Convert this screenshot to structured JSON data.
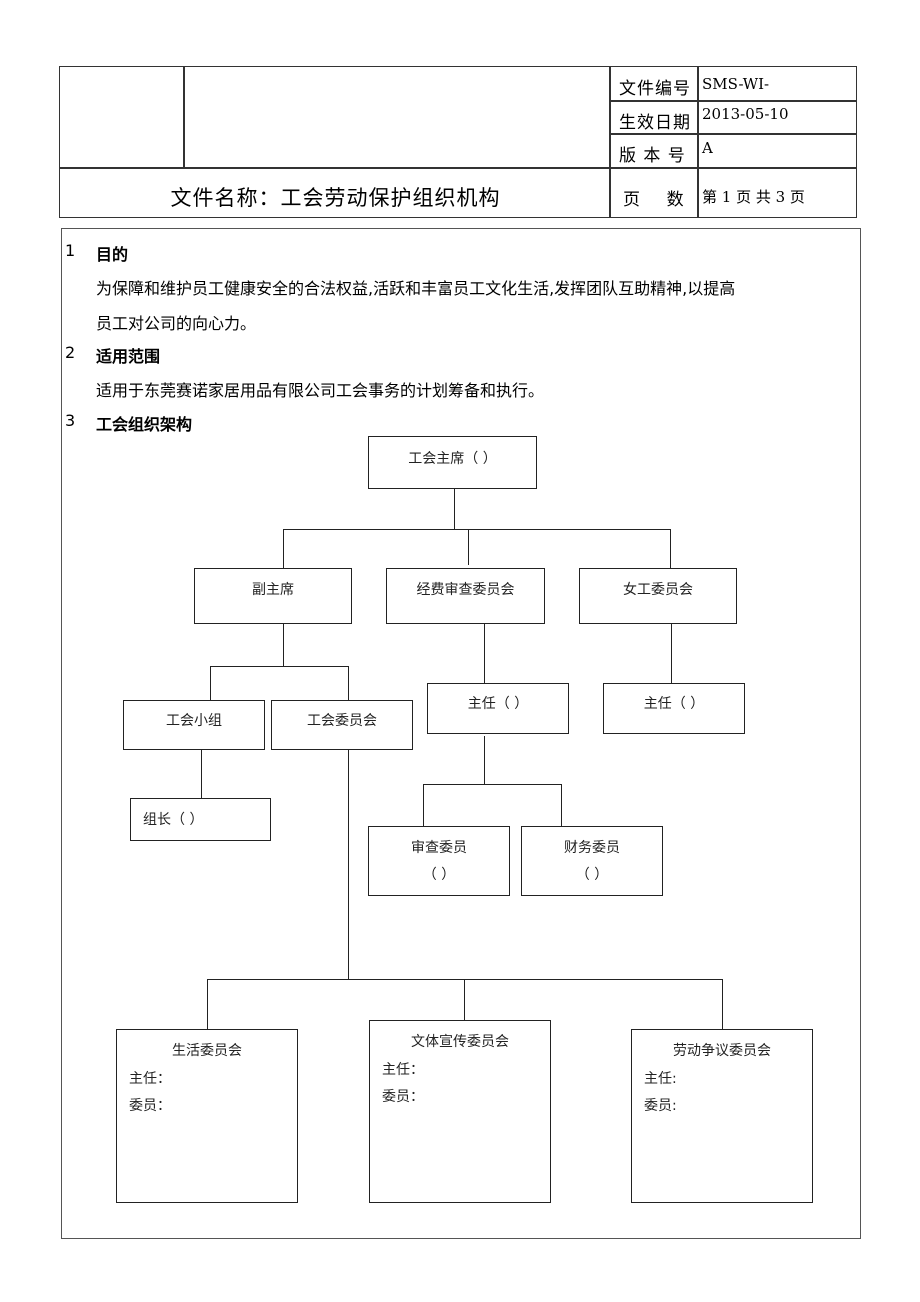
{
  "header": {
    "doc_number_label": "文件编号",
    "doc_number_value": "SMS-WI-",
    "effective_date_label": "生效日期",
    "effective_date_value": "2013-05-10",
    "version_label": "版 本 号",
    "version_value": "A",
    "pages_label": "页    数",
    "pages_value": "第 1 页 共 3 页",
    "doc_title": "文件名称：工会劳动保护组织机构"
  },
  "sections": [
    {
      "num": "1",
      "title": "目的",
      "lines": [
        "为保障和维护员工健康安全的合法权益,活跃和丰富员工文化生活,发挥团队互助精神,以提高",
        "员工对公司的向心力。"
      ]
    },
    {
      "num": "2",
      "title": "适用范围",
      "lines": [
        "适用于东莞赛诺家居用品有限公司工会事务的计划筹备和执行。"
      ]
    },
    {
      "num": "3",
      "title": "工会组织架构",
      "lines": []
    }
  ],
  "org": {
    "chairman": "工会主席（ ）",
    "vice_chairman": "副主席",
    "audit_committee": "经费审查委员会",
    "women_committee": "女工委员会",
    "union_group": "工会小组",
    "union_committee": "工会委员会",
    "audit_director": "主任（ ）",
    "women_director": "主任（ ）",
    "group_leader": "组长（ ）",
    "audit_member": "审查委员",
    "audit_member_paren": "（ ）",
    "finance_member": "财务委员",
    "finance_member_paren": "（ ）",
    "life_committee": {
      "title": "生活委员会",
      "director": "主任：",
      "members": "委员："
    },
    "culture_committee": {
      "title": "文体宣传委员会",
      "director": "主任：",
      "members": "委员："
    },
    "labor_dispute_committee": {
      "title": "劳动争议委员会",
      "director": "主任:",
      "members": "委员:"
    }
  }
}
